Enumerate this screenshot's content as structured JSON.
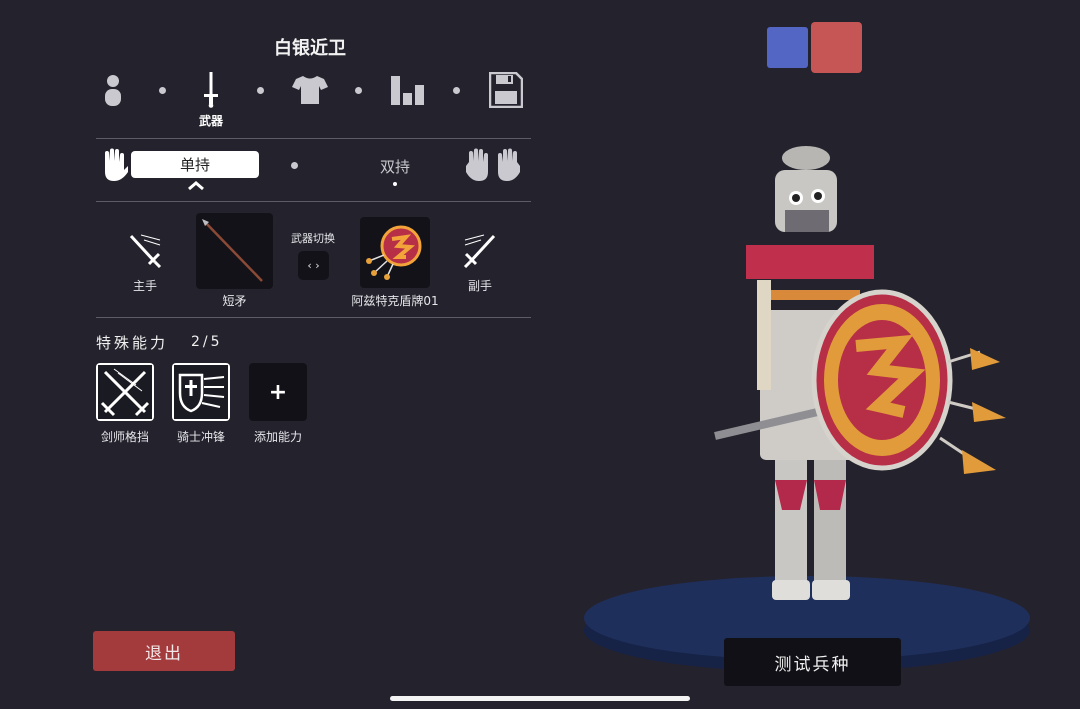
{
  "unit": {
    "name": "白银近卫"
  },
  "steps": [
    {
      "key": "body",
      "icon": "person-icon",
      "label": ""
    },
    {
      "key": "weapon",
      "icon": "sword-icon",
      "label": "武器"
    },
    {
      "key": "clothing",
      "icon": "shirt-icon",
      "label": ""
    },
    {
      "key": "stats",
      "icon": "bar-chart-icon",
      "label": ""
    },
    {
      "key": "save",
      "icon": "floppy-disk-icon",
      "label": ""
    }
  ],
  "grip": {
    "single": "单持",
    "dual": "双持"
  },
  "weapons": {
    "main_hand_label": "主手",
    "off_hand_label": "副手",
    "main_weapon_name": "短矛",
    "off_weapon_name": "阿兹特克盾牌01",
    "swap_label": "武器切换",
    "swap_button": "‹ ›"
  },
  "abilities": {
    "title": "特殊能力",
    "count": "2/5",
    "items": [
      {
        "name": "剑师格挡",
        "icon": "crossed-swords-icon"
      },
      {
        "name": "骑士冲锋",
        "icon": "knight-shield-icon"
      },
      {
        "name": "添加能力",
        "icon": "plus-icon",
        "symbol": "+"
      }
    ]
  },
  "buttons": {
    "exit": "退出",
    "test_unit": "测试兵种"
  },
  "team_colors": [
    "#5466c4",
    "#c65656"
  ]
}
